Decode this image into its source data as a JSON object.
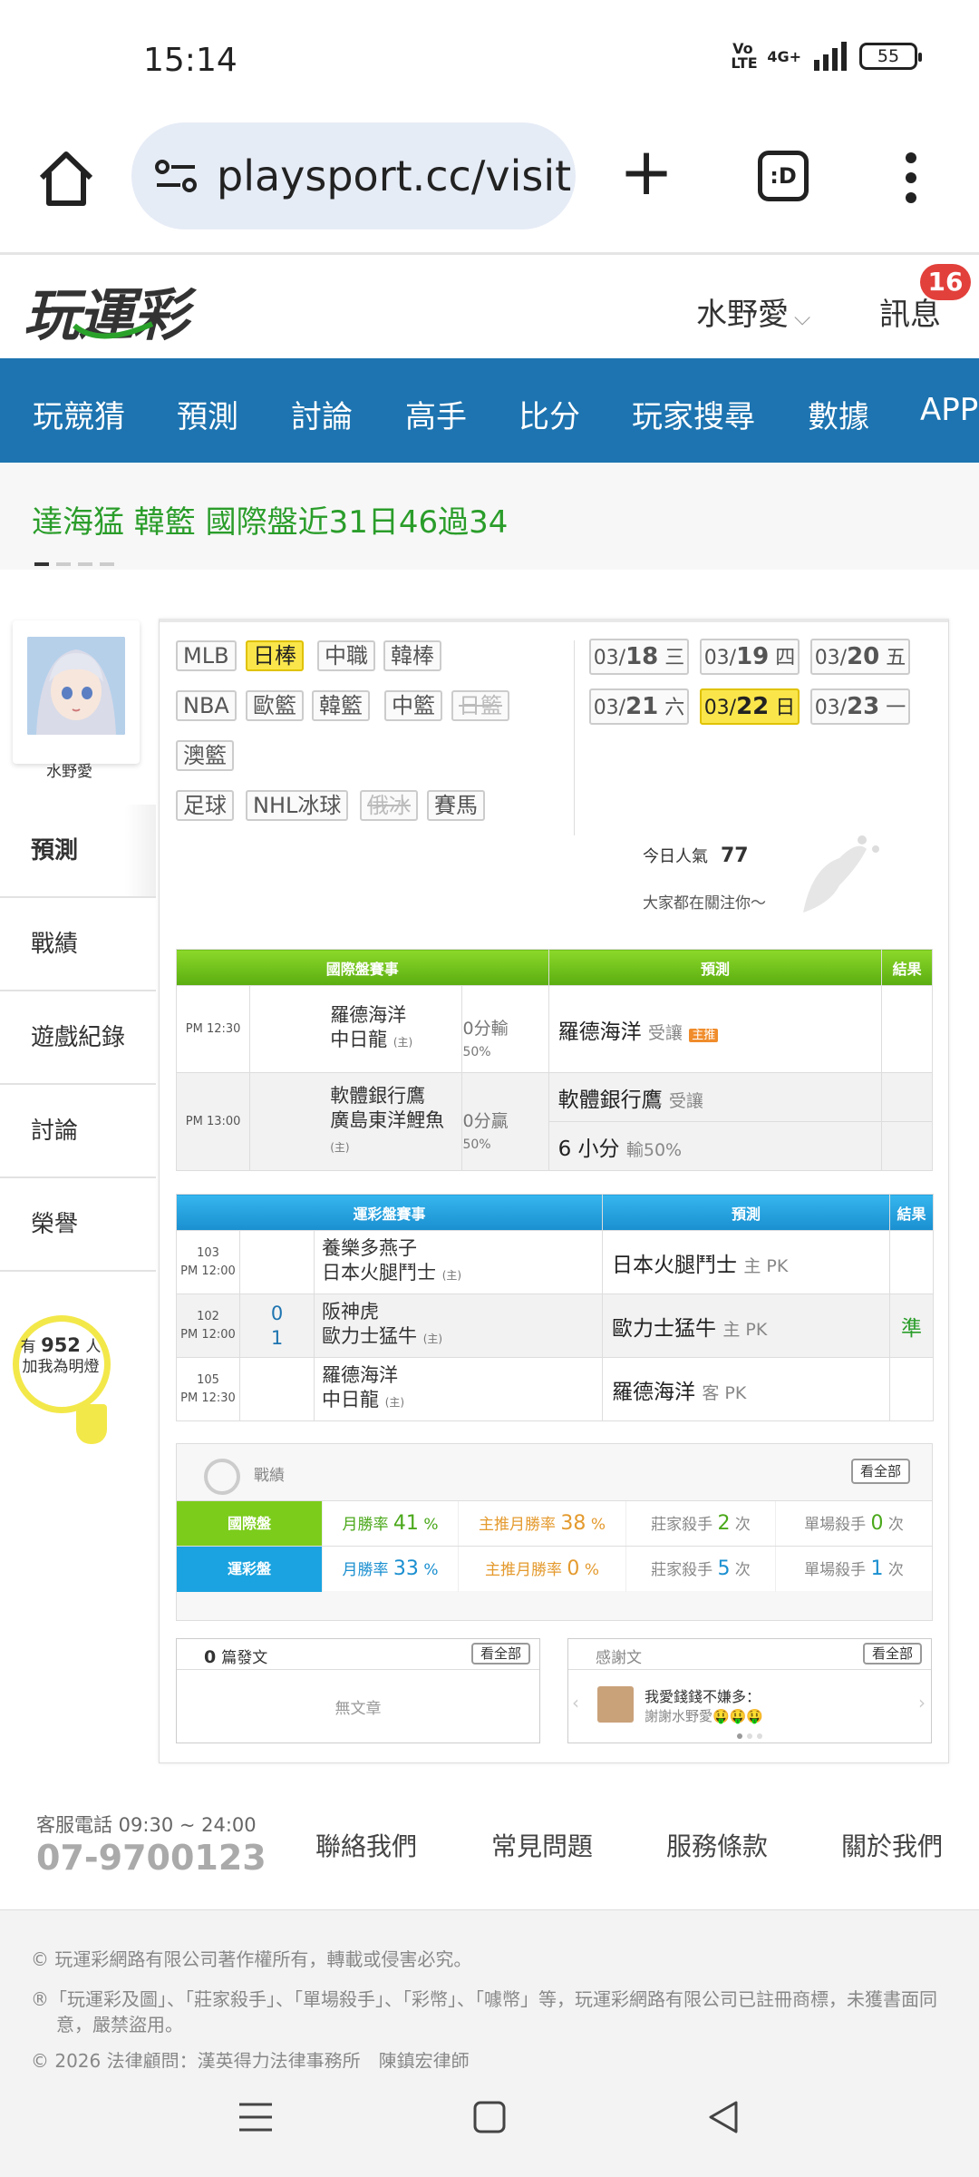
{
  "status": {
    "time": "15:14",
    "volte": "Vo\nLTE",
    "network": "4G+",
    "battery": "55"
  },
  "browser": {
    "url": "playsport.cc/visit",
    "tabs_label": ":D"
  },
  "site": {
    "logo": "玩運彩",
    "user": "水野愛",
    "messages_label": "訊息",
    "messages_count": "16"
  },
  "nav": [
    "玩競猜",
    "預測",
    "討論",
    "高手",
    "比分",
    "玩家搜尋",
    "數據",
    "APP"
  ],
  "ticker": "達海猛 韓籃 國際盤近31日46過34",
  "sidebar": {
    "avatar_name": "水野愛",
    "items": [
      "預測",
      "戰績",
      "遊戲紀錄",
      "討論",
      "榮譽"
    ],
    "fans_prefix": "有",
    "fans_count": "952",
    "fans_suffix": "人",
    "fans_text": "加我為明燈"
  },
  "leagues": {
    "row1": [
      "MLB",
      "日棒",
      "中職",
      "韓棒"
    ],
    "row2": [
      "NBA",
      "歐籃",
      "韓籃",
      "中籃",
      "日籃"
    ],
    "row3": [
      "澳籃"
    ],
    "row4": [
      "足球",
      "NHL冰球",
      "俄冰",
      "賽馬"
    ],
    "selected": "日棒",
    "disabled": [
      "日籃",
      "俄冰"
    ]
  },
  "dates": [
    {
      "md": "03/",
      "d": "18",
      "w": "三"
    },
    {
      "md": "03/",
      "d": "19",
      "w": "四"
    },
    {
      "md": "03/",
      "d": "20",
      "w": "五"
    },
    {
      "md": "03/",
      "d": "21",
      "w": "六"
    },
    {
      "md": "03/",
      "d": "22",
      "w": "日"
    },
    {
      "md": "03/",
      "d": "23",
      "w": "一"
    }
  ],
  "selected_date": "22",
  "popularity": {
    "label": "今日人氣",
    "value": "77",
    "note": "大家都在關注你～"
  },
  "intl_table": {
    "headers": [
      "國際盤賽事",
      "預測",
      "結果"
    ],
    "rows": [
      {
        "time": "PM 12:30",
        "away": "羅德海洋",
        "home": "中日龍",
        "home_tag": "(主)",
        "line1": "0分輸",
        "line2": "50%",
        "pred": "羅德海洋",
        "pred_type": "受讓",
        "badge": "主推",
        "result": ""
      },
      {
        "time": "PM 13:00",
        "away": "軟體銀行鷹",
        "home": "廣島東洋鯉魚",
        "home_tag": "(主)",
        "line1": "0分贏",
        "line2": "50%",
        "pred": "軟體銀行鷹",
        "pred_type": "受讓",
        "pred2": "6 小分",
        "pred2_type": "輸50%",
        "result": ""
      }
    ]
  },
  "sports_table": {
    "headers": [
      "運彩盤賽事",
      "預測",
      "結果"
    ],
    "rows": [
      {
        "num": "103",
        "time": "PM 12:00",
        "s1": "",
        "s2": "",
        "away": "養樂多燕子",
        "home": "日本火腿鬥士",
        "home_tag": "(主)",
        "pred": "日本火腿鬥士",
        "pred_type": "主 PK",
        "result": ""
      },
      {
        "num": "102",
        "time": "PM 12:00",
        "s1": "0",
        "s2": "1",
        "away": "阪神虎",
        "home": "歐力士猛牛",
        "home_tag": "(主)",
        "pred": "歐力士猛牛",
        "pred_type": "主 PK",
        "result": "準"
      },
      {
        "num": "105",
        "time": "PM 12:30",
        "s1": "",
        "s2": "",
        "away": "羅德海洋",
        "home": "中日龍",
        "home_tag": "(主)",
        "pred": "羅德海洋",
        "pred_type": "客 PK",
        "result": ""
      }
    ]
  },
  "stats": {
    "title": "戰績",
    "see_all": "看全部",
    "rows": [
      {
        "label": "國際盤",
        "color": "#7ccc1c",
        "month_label": "月勝率",
        "month": "41",
        "main_label": "主推月勝率",
        "main": "38",
        "banker_label": "莊家殺手",
        "banker": "2",
        "single_label": "單場殺手",
        "single": "0"
      },
      {
        "label": "運彩盤",
        "color": "#1aa3e0",
        "month_label": "月勝率",
        "month": "33",
        "main_label": "主推月勝率",
        "main": "0",
        "banker_label": "莊家殺手",
        "banker": "5",
        "single_label": "單場殺手",
        "single": "1"
      }
    ],
    "pct": "%",
    "times": "次"
  },
  "articles": {
    "count": "0",
    "label": "篇發文",
    "see_all": "看全部",
    "empty": "無文章"
  },
  "thanks": {
    "label": "感謝文",
    "see_all": "看全部",
    "title": "我愛錢錢不嫌多：",
    "text": "謝謝水野愛🤑🤑🤑"
  },
  "footer": {
    "phone_label": "客服電話 09:30 ~ 24:00",
    "phone": "07-9700123",
    "links": [
      "聯絡我們",
      "常見問題",
      "服務條款",
      "關於我們"
    ],
    "legal1": "© 玩運彩網路有限公司著作權所有，轉載或侵害必究。",
    "legal2": "®「玩運彩及圖」、「莊家殺手」、「單場殺手」、「彩幣」、「噱幣」等，玩運彩網路有限公司已註冊商標，未獲書面同意，嚴禁盜用。",
    "legal3": "© 2026 法律顧問：漢英得力法律事務所　陳鎮宏律師"
  }
}
